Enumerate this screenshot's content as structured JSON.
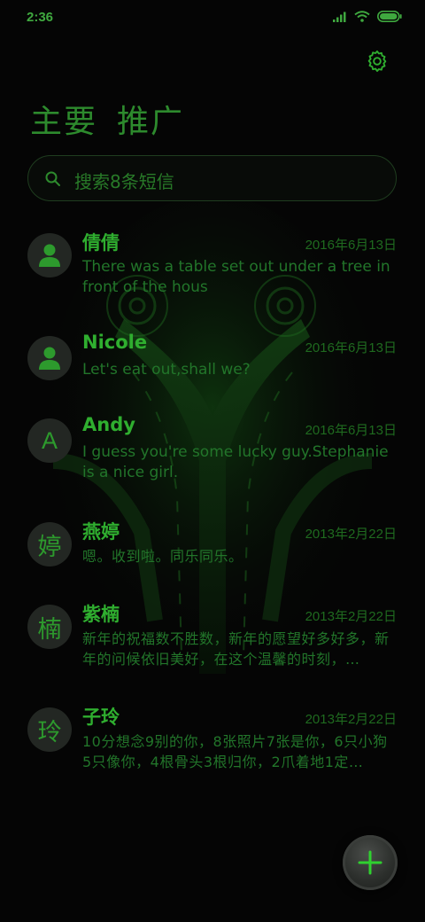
{
  "status": {
    "time": "2:36",
    "icons": [
      "signal-icon",
      "wifi-icon",
      "battery-icon"
    ]
  },
  "header": {
    "settings_icon": "gear-icon",
    "tabs": [
      {
        "label": "主要"
      },
      {
        "label": "推广"
      }
    ]
  },
  "search": {
    "placeholder": "搜索8条短信",
    "icon": "search-icon"
  },
  "threads": [
    {
      "name": "倩倩",
      "date": "2016年6月13日",
      "avatar": "person-icon",
      "snippet": "There was a table set out under a tree in front of the hous"
    },
    {
      "name": "Nicole",
      "date": "2016年6月13日",
      "avatar": "person-icon",
      "snippet": "Let's eat out,shall we?"
    },
    {
      "name": "Andy",
      "date": "2016年6月13日",
      "avatar_letter": "A",
      "snippet": "I guess you're some lucky guy.Stephanie is a nice girl."
    },
    {
      "name": "燕婷",
      "date": "2013年2月22日",
      "avatar_letter": "婷",
      "snippet": "嗯。收到啦。同乐同乐。"
    },
    {
      "name": "紫楠",
      "date": "2013年2月22日",
      "avatar_letter": "楠",
      "snippet": "新年的祝福数不胜数，新年的愿望好多好多，新年的问候依旧美好，在这个温馨的时刻，…"
    },
    {
      "name": "子玲",
      "date": "2013年2月22日",
      "avatar_letter": "玲",
      "snippet": "10分想念9别的你，8张照片7张是你，6只小狗5只像你，4根骨头3根归你，2爪着地1定…"
    }
  ],
  "fab": {
    "icon": "plus-icon"
  },
  "colors": {
    "accent": "#2fae2f",
    "background": "#050505",
    "dim_text": "#22752a"
  }
}
